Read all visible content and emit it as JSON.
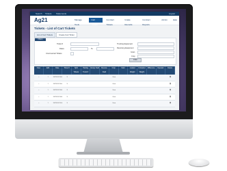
{
  "app": {
    "logo": "Ag21",
    "topbar": [
      "Search",
      "Tickets",
      "Statements"
    ],
    "topbar_right": "Logout",
    "nav": [
      "Manage Tools",
      "Cart Tickets",
      "Contract Tickets",
      "Grade Records",
      "Contract Reports",
      "Admin",
      "Help"
    ],
    "nav_active_index": 1
  },
  "page": {
    "title": "Tickets - List of Cart Tickets",
    "tabs": [
      "List of Cart Tickets",
      "Create Cart Ticket"
    ]
  },
  "filter": {
    "section_label": "Filters",
    "left_labels": [
      "Ticket #",
      "Dates",
      "Unconverted Tickets"
    ],
    "to_label": "To",
    "right_labels": [
      "Trucking Equipment",
      "Receiving Equipment",
      "Grain",
      "Crop"
    ],
    "button_label": "Filter"
  },
  "table": {
    "headers": [
      "View",
      "Edit",
      "Date",
      "Ticket #",
      "Split Tickets",
      "Hauling Truck #",
      "Empty Field",
      "Receive Field",
      "Crop",
      "Field",
      "Loaded Weight",
      "Unloaded Weight",
      "Difference",
      "Operator",
      "Delete"
    ],
    "rows": [
      [
        "",
        "",
        "11/21/14 19:02",
        "3",
        "",
        "",
        "",
        "",
        "Corn",
        "",
        "",
        "",
        "",
        "",
        ""
      ],
      [
        "",
        "",
        "11/21/14 19:04",
        "3",
        "",
        "",
        "",
        "",
        "Corn",
        "",
        "",
        "",
        "",
        "",
        ""
      ],
      [
        "",
        "",
        "11/21/14 19:06",
        "3",
        "",
        "",
        "",
        "",
        "Corn",
        "",
        "",
        "",
        "",
        "",
        ""
      ],
      [
        "",
        "",
        "11/21/14 19:08",
        "3",
        "",
        "",
        "",
        "",
        "Corn",
        "",
        "",
        "",
        "",
        "",
        ""
      ],
      [
        "",
        "",
        "11/21/14 19:10",
        "3",
        "",
        "",
        "",
        "",
        "Corn",
        "",
        "",
        "",
        "",
        "",
        ""
      ]
    ]
  },
  "colors": {
    "nav_blue": "#123a63",
    "accent": "#1a5a99",
    "header_row": "#244a74"
  },
  "icons": {
    "view": "magnifier-icon",
    "edit": "pencil-icon",
    "delete": "trash-icon",
    "apple": "apple-logo-icon"
  }
}
